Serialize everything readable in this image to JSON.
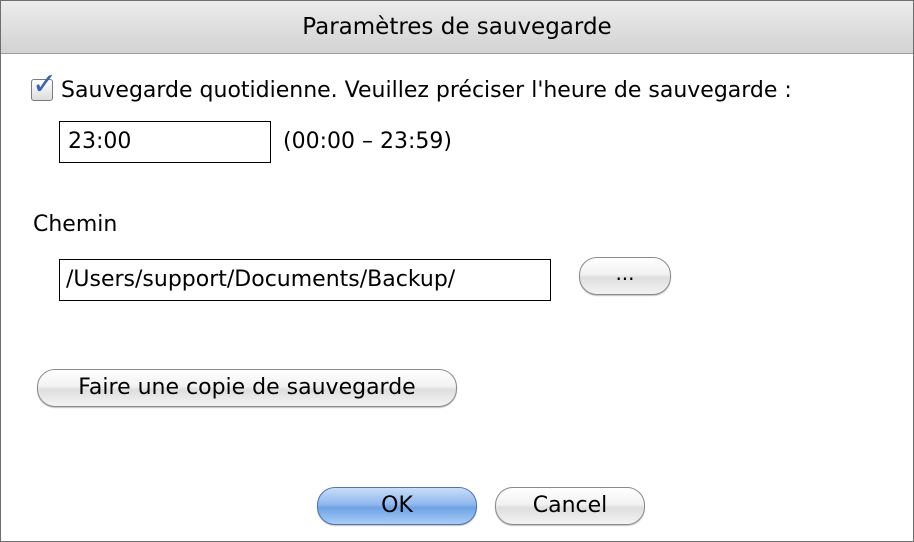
{
  "dialog": {
    "title": "Paramètres de sauvegarde"
  },
  "daily_backup": {
    "checked": true,
    "label": "Sauvegarde quotidienne. Veuillez préciser l'heure de sauvegarde :",
    "time_value": "23:00",
    "time_range": "(00:00 – 23:59)"
  },
  "path": {
    "label": "Chemin",
    "value": "/Users/support/Documents/Backup/",
    "browse_label": "..."
  },
  "actions": {
    "backup_now_label": "Faire une copie de sauvegarde",
    "ok_label": "OK",
    "cancel_label": "Cancel"
  },
  "colors": {
    "ok_button": "#8fb8ee",
    "checkmark": "#3a63b3"
  }
}
